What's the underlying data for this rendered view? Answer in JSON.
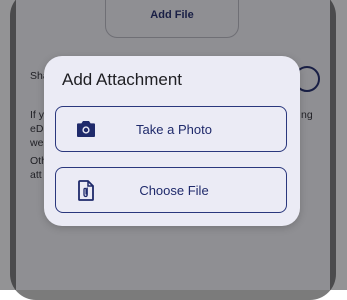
{
  "background": {
    "add_file_label": "Add File",
    "share_text": "Sha",
    "paragraph1_lines": [
      "If y",
      "eDi",
      "we"
    ],
    "paragraph1_right": "ng",
    "paragraph2_lines": [
      "Oth",
      "att"
    ]
  },
  "dialog": {
    "title": "Add Attachment",
    "options": [
      {
        "label": "Take a Photo",
        "icon": "camera-icon"
      },
      {
        "label": "Choose File",
        "icon": "file-attachment-icon"
      }
    ]
  },
  "colors": {
    "accent": "#1f2a6b",
    "dialog_bg": "#ebebf5",
    "frame": "#7b7b7b"
  }
}
